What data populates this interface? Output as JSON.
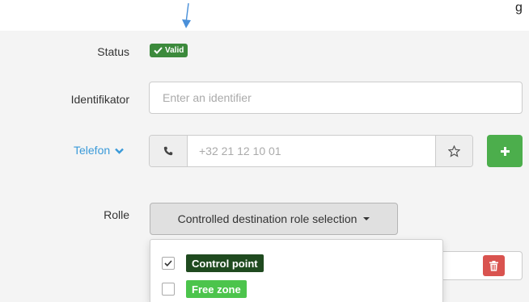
{
  "edge_text": "g",
  "form": {
    "status": {
      "label": "Status",
      "badge": "Valid",
      "badge_icon": "checkmark-icon",
      "badge_color": "#3c8a3c"
    },
    "identifier": {
      "label": "Identifikator",
      "placeholder": "Enter an identifier",
      "value": ""
    },
    "phone": {
      "label": "Telefon",
      "label_icon": "chevron-down-icon",
      "placeholder": "+32 21 12 10 01",
      "value": "",
      "left_icon": "phone-icon",
      "right_icon": "star-icon",
      "add_icon": "plus-icon",
      "add_color": "#4cae4c"
    },
    "role": {
      "label": "Rolle",
      "button_label": "Controlled destination role selection",
      "options": [
        {
          "label": "Control point",
          "checked": true,
          "color": "#1f4a1f"
        },
        {
          "label": "Free zone",
          "checked": false,
          "color": "#4cc44c"
        }
      ]
    },
    "delete_icon": "trash-icon",
    "delete_color": "#d9534f"
  }
}
